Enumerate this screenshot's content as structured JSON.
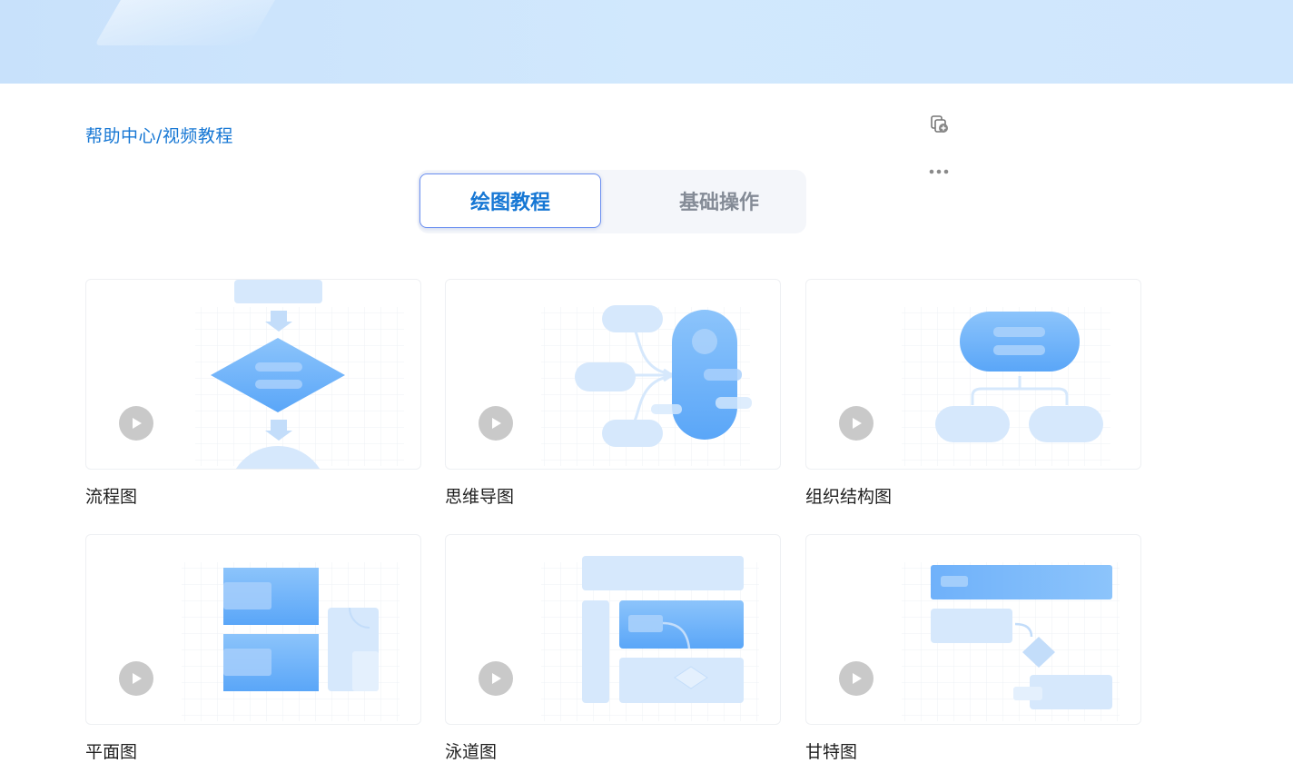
{
  "breadcrumb": "帮助中心/视频教程",
  "tabs": [
    {
      "label": "绘图教程",
      "active": true
    },
    {
      "label": "基础操作",
      "active": false
    }
  ],
  "icons": {
    "copy": "copy-add-icon",
    "more": "more-horizontal-icon",
    "play": "play-icon"
  },
  "colors": {
    "accent": "#1677d4",
    "banner": "#cfe6fd",
    "shape_light": "#d6e8fc",
    "shape_blue": "#5aa6f8"
  },
  "cards": [
    {
      "label": "流程图"
    },
    {
      "label": "思维导图"
    },
    {
      "label": "组织结构图"
    },
    {
      "label": "平面图"
    },
    {
      "label": "泳道图"
    },
    {
      "label": "甘特图"
    }
  ]
}
